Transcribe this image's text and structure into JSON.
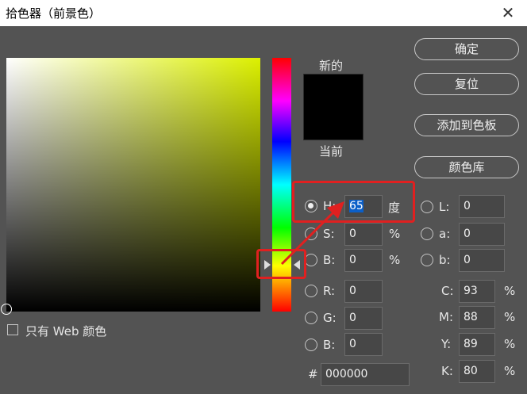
{
  "window": {
    "title": "拾色器（前景色）"
  },
  "swatch": {
    "new_label": "新的",
    "current_label": "当前"
  },
  "buttons": {
    "ok": "确定",
    "reset": "复位",
    "add_to_swatches": "添加到色板",
    "color_libraries": "颜色库"
  },
  "hsb": {
    "h": {
      "label": "H:",
      "value": "65",
      "unit": "度"
    },
    "s": {
      "label": "S:",
      "value": "0",
      "unit": "%"
    },
    "b": {
      "label": "B:",
      "value": "0",
      "unit": "%"
    }
  },
  "lab": {
    "l": {
      "label": "L:",
      "value": "0"
    },
    "a": {
      "label": "a:",
      "value": "0"
    },
    "b": {
      "label": "b:",
      "value": "0"
    }
  },
  "rgb": {
    "r": {
      "label": "R:",
      "value": "0"
    },
    "g": {
      "label": "G:",
      "value": "0"
    },
    "b": {
      "label": "B:",
      "value": "0"
    }
  },
  "cmyk": {
    "c": {
      "label": "C:",
      "value": "93",
      "unit": "%"
    },
    "m": {
      "label": "M:",
      "value": "88",
      "unit": "%"
    },
    "y": {
      "label": "Y:",
      "value": "89",
      "unit": "%"
    },
    "k": {
      "label": "K:",
      "value": "80",
      "unit": "%"
    }
  },
  "hex": {
    "label": "#",
    "value": "000000"
  },
  "web_only": {
    "label": "只有 Web 颜色"
  },
  "colors": {
    "annotation": "#e02020",
    "field_color": "#dcf000",
    "selection": "#0b5fc8"
  },
  "icons": {
    "close": "close-icon"
  }
}
